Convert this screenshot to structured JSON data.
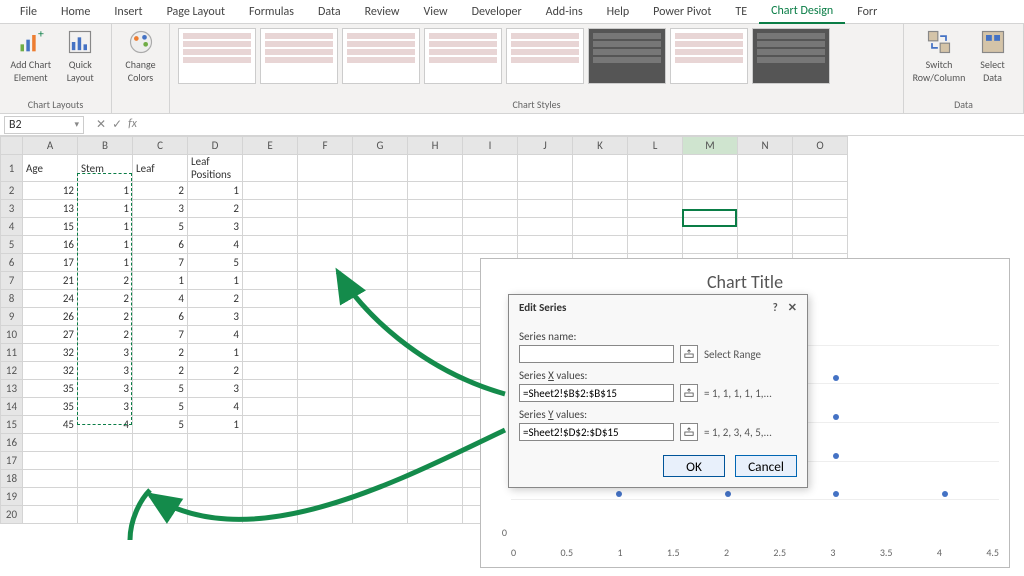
{
  "tabs": [
    "File",
    "Home",
    "Insert",
    "Page Layout",
    "Formulas",
    "Data",
    "Review",
    "View",
    "Developer",
    "Add-ins",
    "Help",
    "Power Pivot",
    "TE",
    "Chart Design",
    "Forr"
  ],
  "active_tab": "Chart Design",
  "ribbon": {
    "layouts": {
      "add_chart_element": "Add Chart Element",
      "quick_layout": "Quick Layout",
      "group": "Chart Layouts"
    },
    "colors": {
      "change_colors": "Change Colors"
    },
    "styles_group": "Chart Styles",
    "data": {
      "switch": "Switch Row/Column",
      "select": "Select Data",
      "group": "Data"
    }
  },
  "namebox": "B2",
  "columns": [
    "A",
    "B",
    "C",
    "D",
    "E",
    "F",
    "G",
    "H",
    "I",
    "J",
    "K",
    "L",
    "M",
    "N",
    "O"
  ],
  "selected_col": "M",
  "headers": {
    "A": "Age",
    "B": "Stem",
    "C": "Leaf",
    "D": "Leaf Positions"
  },
  "rows": [
    {
      "A": 12,
      "B": 1,
      "C": 2,
      "D": 1
    },
    {
      "A": 13,
      "B": 1,
      "C": 3,
      "D": 2
    },
    {
      "A": 15,
      "B": 1,
      "C": 5,
      "D": 3
    },
    {
      "A": 16,
      "B": 1,
      "C": 6,
      "D": 4
    },
    {
      "A": 17,
      "B": 1,
      "C": 7,
      "D": 5
    },
    {
      "A": 21,
      "B": 2,
      "C": 1,
      "D": 1
    },
    {
      "A": 24,
      "B": 2,
      "C": 4,
      "D": 2
    },
    {
      "A": 26,
      "B": 2,
      "C": 6,
      "D": 3
    },
    {
      "A": 27,
      "B": 2,
      "C": 7,
      "D": 4
    },
    {
      "A": 32,
      "B": 3,
      "C": 2,
      "D": 1
    },
    {
      "A": 32,
      "B": 3,
      "C": 2,
      "D": 2
    },
    {
      "A": 35,
      "B": 3,
      "C": 5,
      "D": 3
    },
    {
      "A": 35,
      "B": 3,
      "C": 5,
      "D": 4
    },
    {
      "A": 45,
      "B": 4,
      "C": 5,
      "D": 1
    }
  ],
  "chart": {
    "title": "Chart Title",
    "x_ticks": [
      "0",
      "0.5",
      "1",
      "1.5",
      "2",
      "2.5",
      "3",
      "3.5",
      "4",
      "4.5"
    ],
    "y_ticks": [
      "0",
      "",
      "",
      "",
      "",
      "",
      ""
    ]
  },
  "chart_data": {
    "type": "scatter",
    "title": "Chart Title",
    "xlabel": "",
    "ylabel": "",
    "xlim": [
      0,
      4.5
    ],
    "ylim": [
      0,
      6
    ],
    "series": [
      {
        "name": "",
        "x": [
          1,
          1,
          1,
          1,
          1,
          2,
          2,
          2,
          2,
          3,
          3,
          3,
          3,
          4
        ],
        "y": [
          1,
          2,
          3,
          4,
          5,
          1,
          2,
          3,
          4,
          1,
          2,
          3,
          4,
          1
        ]
      }
    ]
  },
  "dialog": {
    "title": "Edit Series",
    "name_label": "Series name:",
    "name_value": "",
    "name_hint": "Select Range",
    "x_label_pre": "Series ",
    "x_label_u": "X",
    "x_label_post": " values:",
    "x_value": "=Sheet2!$B$2:$B$15",
    "x_preview": "= 1, 1, 1, 1, 1,...",
    "y_label_pre": "Series ",
    "y_label_u": "Y",
    "y_label_post": " values:",
    "y_value": "=Sheet2!$D$2:$D$15",
    "y_preview": "= 1, 2, 3, 4, 5,...",
    "ok": "OK",
    "cancel": "Cancel"
  }
}
